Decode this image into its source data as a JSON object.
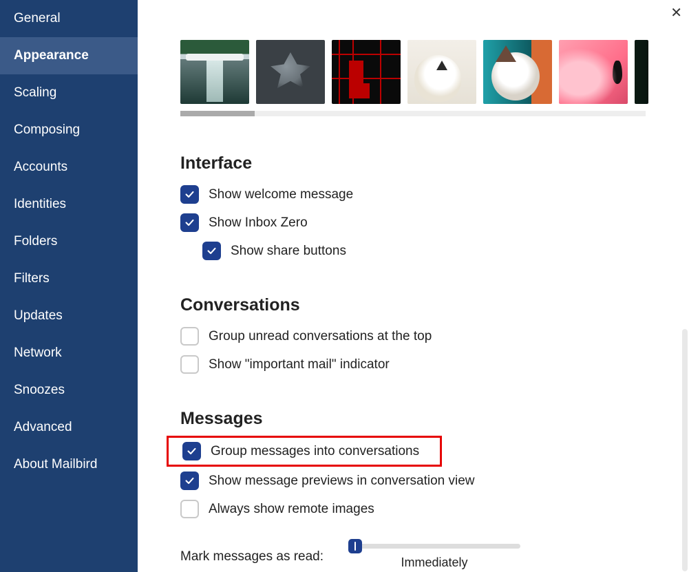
{
  "sidebar": {
    "items": [
      {
        "label": "General"
      },
      {
        "label": "Appearance"
      },
      {
        "label": "Scaling"
      },
      {
        "label": "Composing"
      },
      {
        "label": "Accounts"
      },
      {
        "label": "Identities"
      },
      {
        "label": "Folders"
      },
      {
        "label": "Filters"
      },
      {
        "label": "Updates"
      },
      {
        "label": "Network"
      },
      {
        "label": "Snoozes"
      },
      {
        "label": "Advanced"
      },
      {
        "label": "About Mailbird"
      }
    ],
    "active_index": 1
  },
  "sections": {
    "interface": {
      "title": "Interface",
      "show_welcome": "Show welcome message",
      "show_inbox_zero": "Show Inbox Zero",
      "show_share_buttons": "Show share buttons"
    },
    "conversations": {
      "title": "Conversations",
      "group_unread": "Group unread conversations at the top",
      "show_important": "Show \"important mail\" indicator"
    },
    "messages": {
      "title": "Messages",
      "group_into_conv": "Group messages into conversations",
      "show_previews": "Show message previews in conversation view",
      "always_remote": "Always show remote images",
      "mark_as_read_label": "Mark messages as read:",
      "mark_as_read_value": "Immediately"
    }
  },
  "checkbox_state": {
    "show_welcome": true,
    "show_inbox_zero": true,
    "show_share_buttons": true,
    "group_unread": false,
    "show_important": false,
    "group_into_conv": true,
    "show_previews": true,
    "always_remote": false
  },
  "themes_scroll": {
    "length": 676,
    "handle": 108,
    "position": 0
  },
  "accent_color": "#1e3f8f",
  "sidebar_color": "#1e4070",
  "highlight_color": "#e60000"
}
